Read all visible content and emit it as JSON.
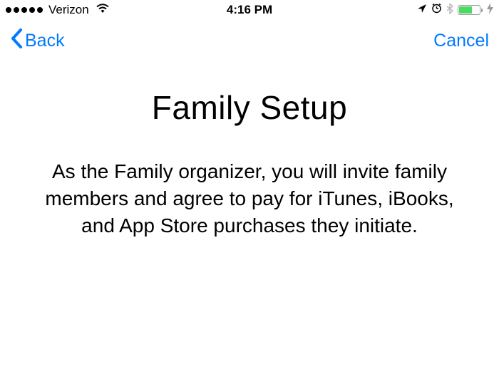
{
  "statusBar": {
    "carrier": "Verizon",
    "time": "4:16 PM"
  },
  "navBar": {
    "backLabel": "Back",
    "cancelLabel": "Cancel"
  },
  "content": {
    "title": "Family Setup",
    "description": "As the Family organizer, you will invite family members and agree to pay for iTunes, iBooks, and App Store purchases they initiate."
  }
}
